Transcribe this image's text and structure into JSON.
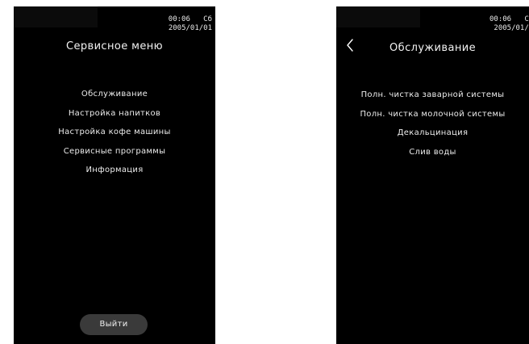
{
  "left_screen": {
    "status": {
      "time": "00:06",
      "day": "Сб",
      "date": "2005/01/01"
    },
    "title": "Сервисное меню",
    "menu": [
      "Обслуживание",
      "Настройка напитков",
      "Настройка кофе машины",
      "Сервисные программы",
      "Информация"
    ],
    "exit_label": "Выйти"
  },
  "right_screen": {
    "status": {
      "time": "00:06",
      "day": "С",
      "date": "2005/01/"
    },
    "back_icon": "chevron-left-icon",
    "title": "Обслуживание",
    "menu": [
      "Полн. чистка заварной системы",
      "Полн. чистка молочной системы",
      "Декальцинация",
      "Слив воды"
    ]
  },
  "colors": {
    "screen_bg": "#000000",
    "text": "#ffffff",
    "button_bg": "#3a3a3a",
    "page_bg": "#ffffff"
  }
}
